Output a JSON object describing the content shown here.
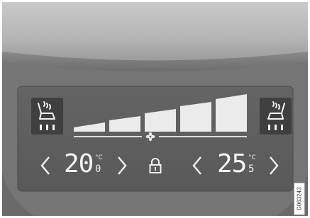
{
  "climate_panel": {
    "driver_temp": {
      "integer": "20",
      "decimal": "0",
      "unit": "°C"
    },
    "passenger_temp": {
      "integer": "25",
      "decimal": "5",
      "unit": "°C"
    },
    "fan_level": {
      "active_bars": 5,
      "total_bars": 5
    },
    "seat_heat_left": {
      "active_segments": 3
    },
    "seat_heat_right": {
      "active_segments": 3
    },
    "icons": {
      "seat_left": "heated-seat-icon",
      "seat_right": "heated-seat-icon",
      "fan": "fan-icon",
      "lock": "lock-icon",
      "driver_down": "chevron-left-icon",
      "driver_up": "chevron-right-icon",
      "passenger_down": "chevron-left-icon",
      "passenger_up": "chevron-right-icon"
    },
    "colors": {
      "panel": "#5e5e5e",
      "surround": "#757575",
      "glyph": "#f2f2f2",
      "seat_button": "#3f3f3f"
    }
  },
  "figure_code": "G063243"
}
